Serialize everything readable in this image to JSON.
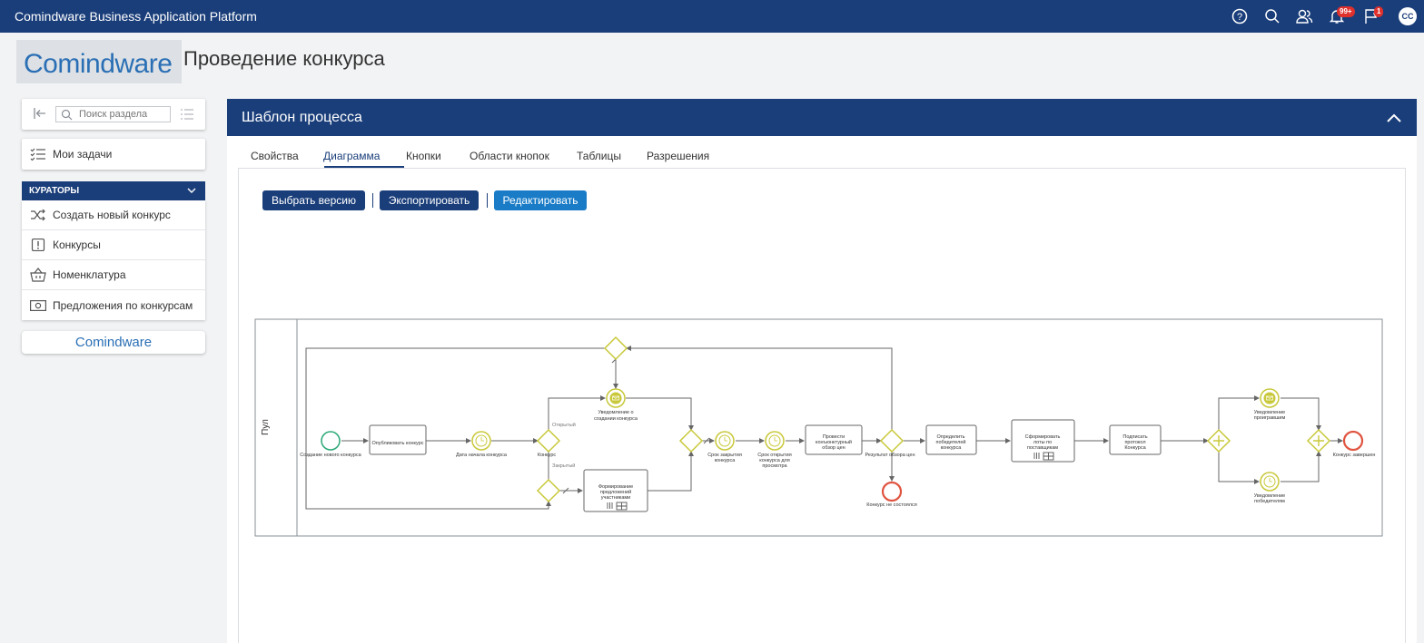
{
  "app": {
    "title": "Comindware Business Application Platform",
    "notifications_badge": "99+",
    "messages_badge": "1",
    "user_initials": "CC"
  },
  "logo": {
    "text": "Comindware"
  },
  "page": {
    "title": "Проведение конкурса"
  },
  "sidebar": {
    "search_placeholder": "Поиск раздела",
    "my_tasks": "Мои задачи",
    "section_header": "КУРАТОРЫ",
    "items": [
      {
        "label": "Создать новый конкурс",
        "icon": "shuffle-icon"
      },
      {
        "label": "Конкурсы",
        "icon": "exclamation-box-icon"
      },
      {
        "label": "Номенклатура",
        "icon": "basket-icon"
      },
      {
        "label": "Предложения по конкурсам",
        "icon": "banknote-icon"
      }
    ],
    "footer_logo": "Comindware"
  },
  "panel": {
    "title": "Шаблон процесса",
    "tabs": [
      {
        "label": "Свойства",
        "active": false
      },
      {
        "label": "Диаграмма",
        "active": true
      },
      {
        "label": "Кнопки",
        "active": false
      },
      {
        "label": "Области кнопок",
        "active": false
      },
      {
        "label": "Таблицы",
        "active": false
      },
      {
        "label": "Разрешения",
        "active": false
      }
    ],
    "buttons": {
      "select_version": "Выбрать версию",
      "export": "Экспортировать",
      "edit": "Редактировать"
    }
  },
  "diagram": {
    "pool_label": "Пул",
    "start_event": "Создание нового конкурса",
    "task_publish": "Опубликовать конкурс",
    "timer_start_date": "Дата начала конкурса",
    "gateway_contest": "Конкурс",
    "flow_open": "Открытый",
    "flow_closed": "Закрытый",
    "msg_created_l1": "Уведомление о",
    "msg_created_l2": "создании конкурса",
    "task_proposals_l1": "Формирование",
    "task_proposals_l2": "предложений",
    "task_proposals_l3": "участниками",
    "timer_close_l1": "Срок закрытия",
    "timer_close_l2": "конкурса",
    "timer_open_l1": "Срок открытия",
    "timer_open_l2": "конкурса для",
    "timer_open_l3": "просмотра",
    "task_review_l1": "Провести",
    "task_review_l2": "конъюнктурный",
    "task_review_l3": "обзор цен",
    "gateway_review": "Результат обзора цен",
    "end_failed": "Конкурс не состоялся",
    "task_winners_l1": "Определить",
    "task_winners_l2": "победителей",
    "task_winners_l3": "конкурса",
    "task_lots_l1": "Сформировать",
    "task_lots_l2": "лоты по",
    "task_lots_l3": "поставщикам",
    "task_sign_l1": "Подписать",
    "task_sign_l2": "протокол",
    "task_sign_l3": "Конкурса",
    "msg_losers_l1": "Уведомление",
    "msg_losers_l2": "проигравшим",
    "msg_winners_l1": "Уведомление",
    "msg_winners_l2": "победителям",
    "end_done": "Конкурс завершен"
  },
  "colors": {
    "brand": "#1a3e7a",
    "accent": "#1a7cc7",
    "gateway": "#c8c83a",
    "start": "#2aa876",
    "end": "#e0533f"
  }
}
